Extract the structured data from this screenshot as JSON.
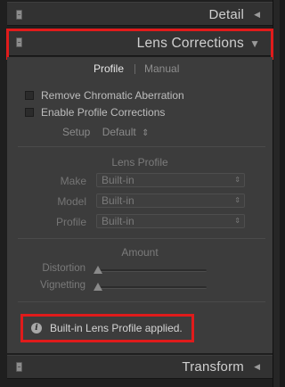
{
  "sections": {
    "detail": {
      "title": "Detail",
      "collapse_glyph": "◀"
    },
    "lens_corrections": {
      "title": "Lens Corrections",
      "collapse_glyph": "▼"
    },
    "transform": {
      "title": "Transform",
      "collapse_glyph": "◀"
    }
  },
  "tabs": {
    "profile": "Profile",
    "manual": "Manual",
    "active": "Profile"
  },
  "checkboxes": [
    {
      "label": "Remove Chromatic Aberration",
      "checked": false
    },
    {
      "label": "Enable Profile Corrections",
      "checked": false
    }
  ],
  "setup": {
    "label": "Setup",
    "value": "Default",
    "arrows": "⇕"
  },
  "lens_profile": {
    "heading": "Lens Profile",
    "make": {
      "label": "Make",
      "value": "Built-in"
    },
    "model": {
      "label": "Model",
      "value": "Built-in"
    },
    "profile": {
      "label": "Profile",
      "value": "Built-in"
    }
  },
  "amount": {
    "heading": "Amount",
    "distortion": {
      "label": "Distortion",
      "value": 0
    },
    "vignetting": {
      "label": "Vignetting",
      "value": 0
    }
  },
  "message": {
    "text": "Built-in Lens Profile applied.",
    "icon": "info-icon"
  },
  "colors": {
    "highlight": "#e01b1b",
    "panel": "#3c3c3c",
    "header": "#323232"
  }
}
